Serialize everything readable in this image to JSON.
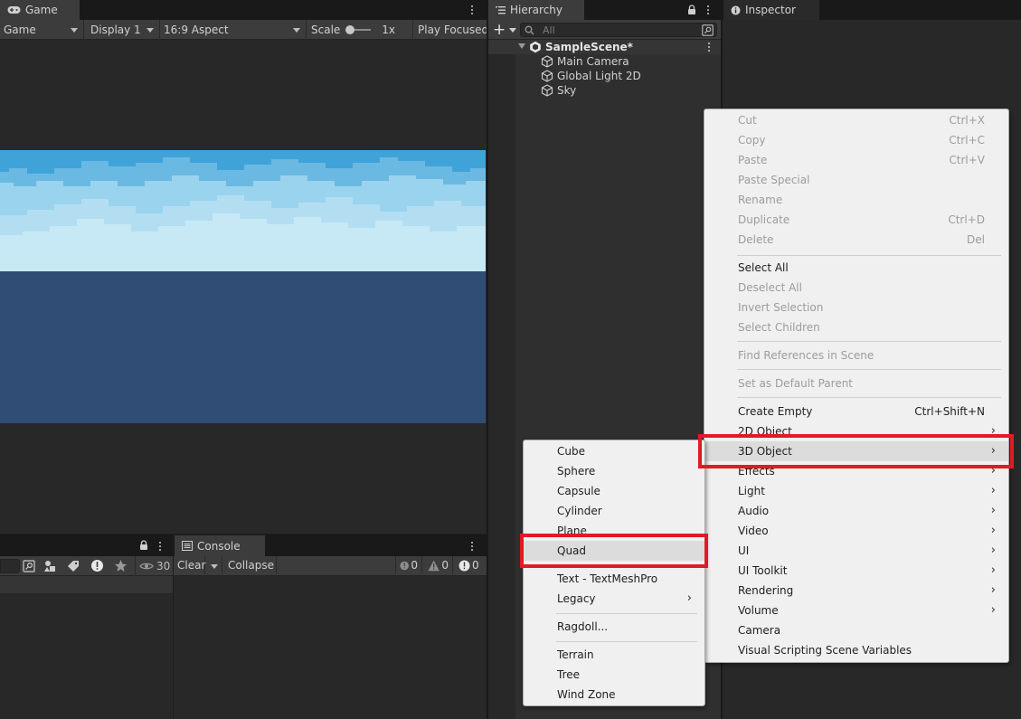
{
  "game": {
    "tab": "Game",
    "mode": "Game",
    "display": "Display 1",
    "aspect": "16:9 Aspect",
    "scale_label": "Scale",
    "scale_value": "1x",
    "play_mode": "Play Focused"
  },
  "hierarchy": {
    "tab": "Hierarchy",
    "search_placeholder": "All",
    "scene": "SampleScene*",
    "items": [
      "Main Camera",
      "Global Light 2D",
      "Sky"
    ]
  },
  "inspector": {
    "tab": "Inspector"
  },
  "project": {
    "badge_count": "30"
  },
  "console": {
    "tab": "Console",
    "clear": "Clear",
    "collapse": "Collapse",
    "log_count": "0",
    "warning_count": "0",
    "error_count": "0"
  },
  "context_menu": {
    "cut": "Cut",
    "cut_sc": "Ctrl+X",
    "copy": "Copy",
    "copy_sc": "Ctrl+C",
    "paste": "Paste",
    "paste_sc": "Ctrl+V",
    "paste_special": "Paste Special",
    "rename": "Rename",
    "duplicate": "Duplicate",
    "duplicate_sc": "Ctrl+D",
    "delete": "Delete",
    "delete_sc": "Del",
    "select_all": "Select All",
    "deselect_all": "Deselect All",
    "invert_selection": "Invert Selection",
    "select_children": "Select Children",
    "find_references": "Find References in Scene",
    "set_default_parent": "Set as Default Parent",
    "create_empty": "Create Empty",
    "create_empty_sc": "Ctrl+Shift+N",
    "object_2d": "2D Object",
    "object_3d": "3D Object",
    "effects": "Effects",
    "light": "Light",
    "audio": "Audio",
    "video": "Video",
    "ui": "UI",
    "ui_toolkit": "UI Toolkit",
    "rendering": "Rendering",
    "volume": "Volume",
    "camera": "Camera",
    "visual_scripting": "Visual Scripting Scene Variables"
  },
  "submenu_3d": {
    "cube": "Cube",
    "sphere": "Sphere",
    "capsule": "Capsule",
    "cylinder": "Cylinder",
    "plane": "Plane",
    "quad": "Quad",
    "text_mesh_pro": "Text - TextMeshPro",
    "legacy": "Legacy",
    "ragdoll": "Ragdoll...",
    "terrain": "Terrain",
    "tree": "Tree",
    "wind_zone": "Wind Zone"
  },
  "colors": {
    "highlight_box": "#e01b24",
    "sky_top": "#3fa3d9",
    "sky_light": "#c6e9f5",
    "ground": "#304d75"
  }
}
